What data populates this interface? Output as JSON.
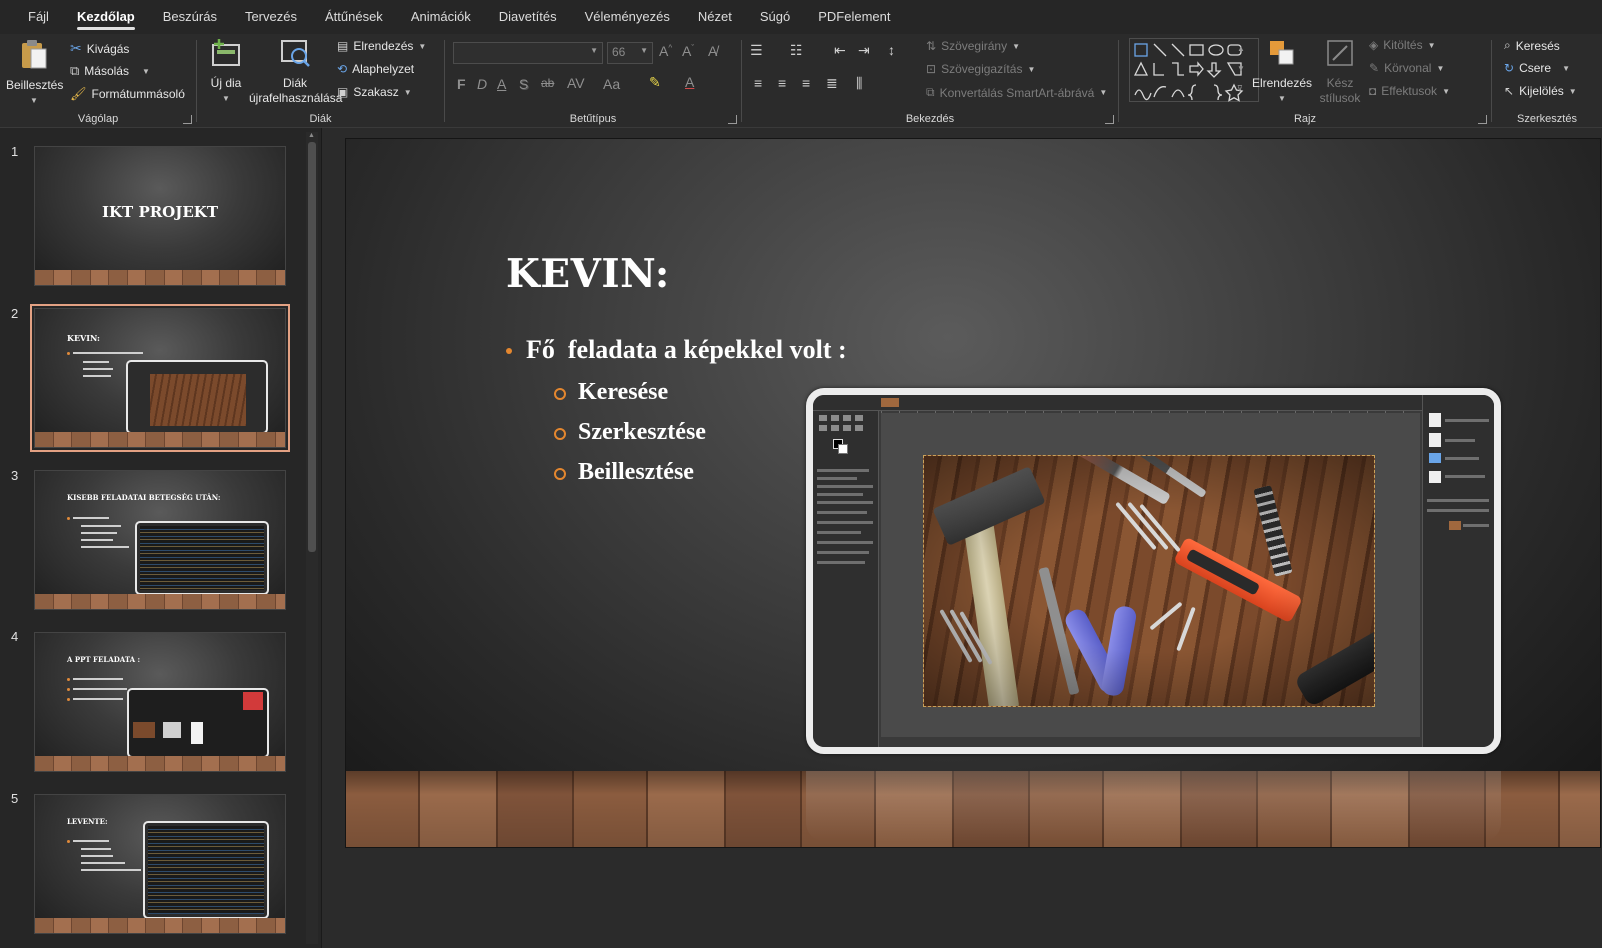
{
  "menu": {
    "tabs": [
      "Fájl",
      "Kezdőlap",
      "Beszúrás",
      "Tervezés",
      "Áttűnések",
      "Animációk",
      "Diavetítés",
      "Véleményezés",
      "Nézet",
      "Súgó",
      "PDFelement"
    ],
    "active": "Kezdőlap"
  },
  "ribbon": {
    "clipboard": {
      "label": "Vágólap",
      "paste": "Beillesztés",
      "cut": "Kivágás",
      "copy": "Másolás",
      "format_painter": "Formátummásoló"
    },
    "slides": {
      "label": "Diák",
      "new_slide": "Új dia",
      "reuse_line1": "Diák",
      "reuse_line2": "újrafelhasználása",
      "layout": "Elrendezés",
      "reset": "Alaphelyzet",
      "section": "Szakasz"
    },
    "font": {
      "label": "Betűtípus",
      "font_name": "",
      "font_size": "66",
      "buttons": [
        "F",
        "D",
        "A",
        "S",
        "ab",
        "AV",
        "Aa"
      ]
    },
    "paragraph": {
      "label": "Bekezdés",
      "text_direction": "Szövegirány",
      "align_text": "Szövegigazítás",
      "smartart": "Konvertálás SmartArt-ábrává"
    },
    "drawing": {
      "label": "Rajz",
      "arrange": "Elrendezés",
      "quick_styles_line1": "Kész",
      "quick_styles_line2": "stílusok",
      "fill": "Kitöltés",
      "outline": "Körvonal",
      "effects": "Effektusok"
    },
    "editing": {
      "label": "Szerkesztés",
      "find": "Keresés",
      "replace": "Csere",
      "select": "Kijelölés"
    }
  },
  "slides": [
    {
      "number": "1",
      "title": "IKT PROJEKT"
    },
    {
      "number": "2",
      "title": "KEVIN:",
      "selected": true
    },
    {
      "number": "3",
      "title": "KISEBB FELADATAI BETEGSÉG UTÁN:"
    },
    {
      "number": "4",
      "title": "A PPT FELADATA :"
    },
    {
      "number": "5",
      "title": "LEVENTE:"
    }
  ],
  "current_slide": {
    "title": "KEVIN:",
    "bullet": "Fő  feladata a képekkel volt :",
    "sub_bullets": [
      "Keresése",
      "Szerkesztése",
      "Beillesztése"
    ]
  },
  "colors": {
    "accent_bullet": "#e4872f",
    "selected_thumb_border": "#e3a183"
  }
}
